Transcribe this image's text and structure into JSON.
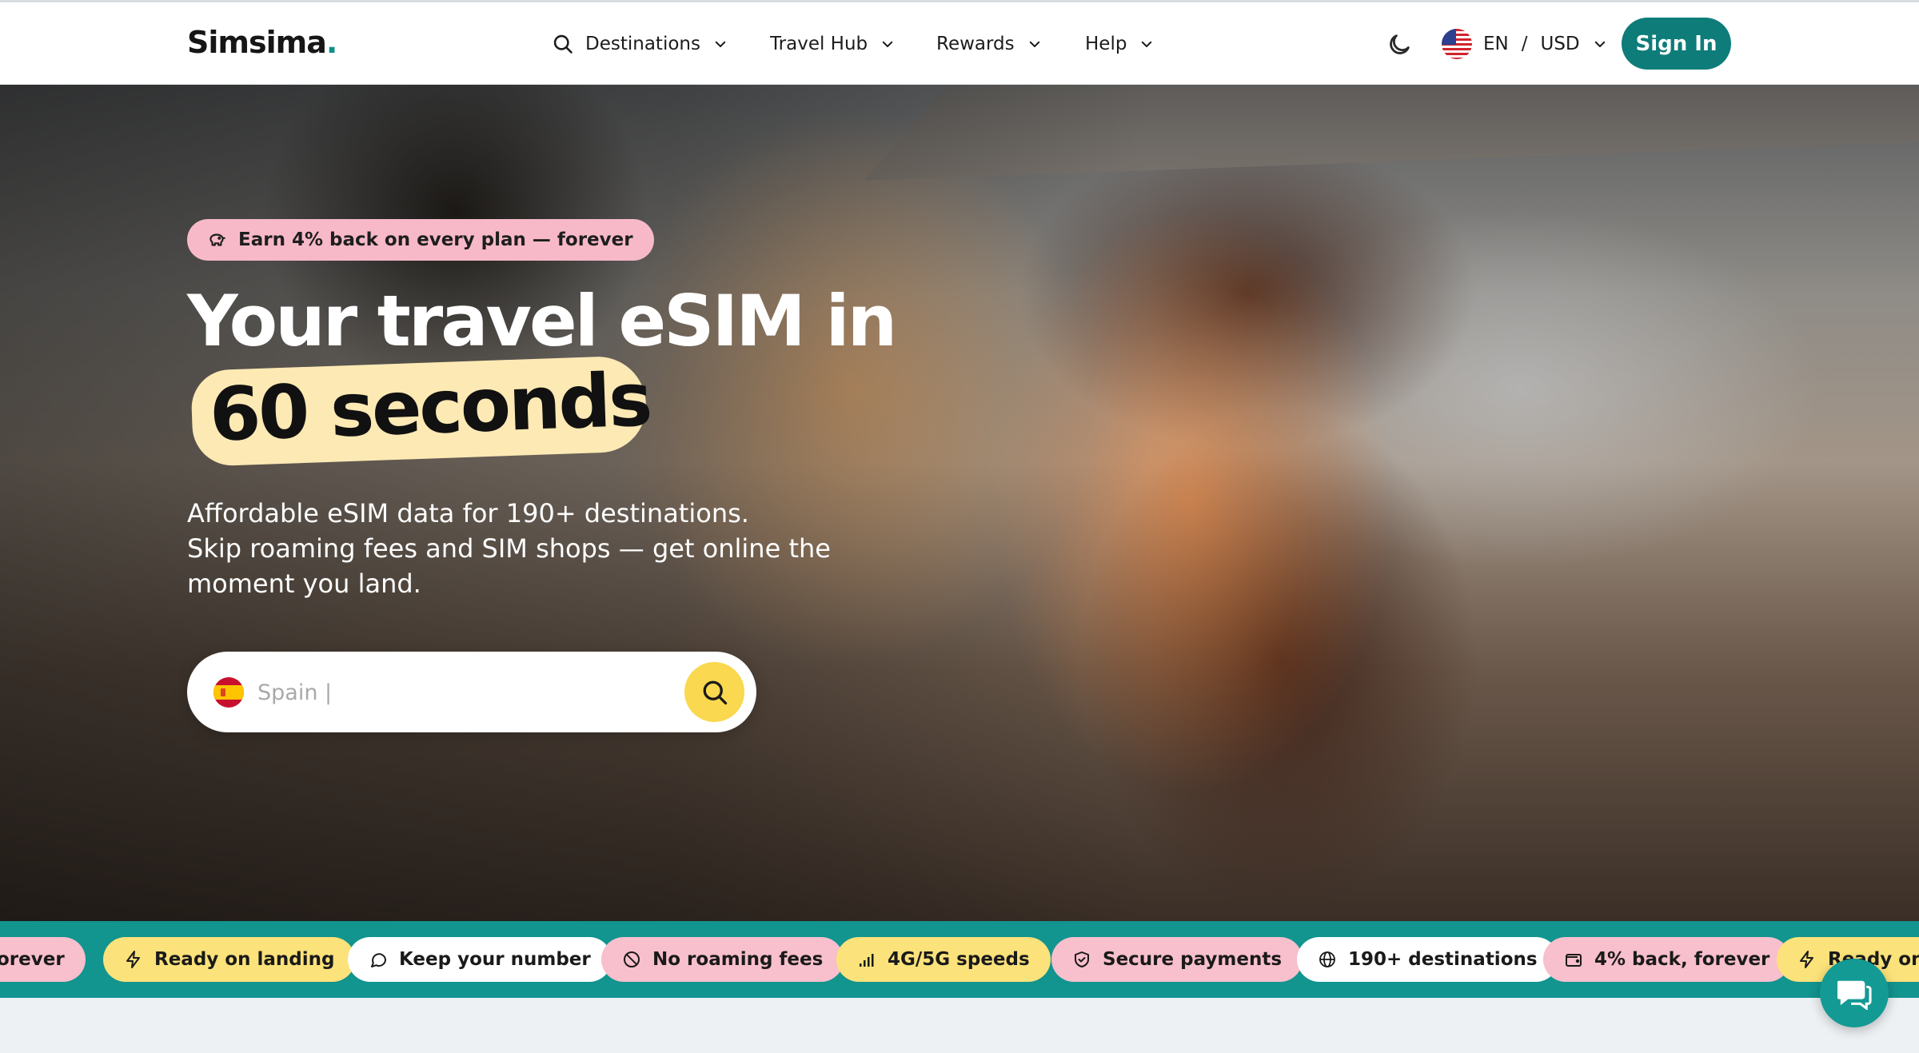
{
  "header": {
    "logo": "Simsima",
    "logo_dot": ".",
    "nav": {
      "destinations": "Destinations",
      "travel_hub": "Travel Hub",
      "rewards": "Rewards",
      "help": "Help"
    },
    "locale": {
      "language": "EN",
      "separator": "/",
      "currency": "USD"
    },
    "sign_in": "Sign In"
  },
  "hero": {
    "badge": "Earn 4% back on every plan — forever",
    "headline_line1": "Your travel eSIM in",
    "headline_highlight": "60 seconds",
    "subtitle_line1": "Affordable eSIM data for 190+ destinations.",
    "subtitle_line2": "Skip roaming fees and SIM shops — get online the",
    "subtitle_line3": "moment you land.",
    "search": {
      "placeholder": "Spain |"
    }
  },
  "features": {
    "p0": "forever",
    "p1": "Ready on landing",
    "p2": "Keep your number",
    "p3": "No roaming fees",
    "p4": "4G/5G speeds",
    "p5": "Secure payments",
    "p6": "190+ destinations",
    "p7": "4% back, forever",
    "p8": "Ready on l"
  },
  "colors": {
    "brand_teal": "#0e7c78",
    "strip_teal": "#12948f",
    "highlight_yellow": "#fde9b4",
    "search_button_yellow": "#fad84f",
    "badge_pink": "#f7b9c8"
  },
  "icons": [
    "search-icon",
    "chevron-down-icon",
    "moon-icon",
    "us-flag-icon",
    "piggy-bank-icon",
    "spain-flag-icon",
    "lightning-icon",
    "chat-bubble-icon",
    "no-entry-icon",
    "signal-bars-icon",
    "shield-icon",
    "globe-icon",
    "wallet-icon",
    "chat-widget-icon"
  ]
}
